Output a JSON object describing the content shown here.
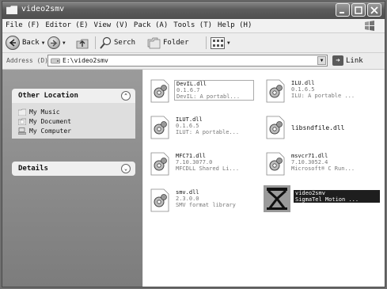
{
  "window": {
    "title": "video2smv"
  },
  "menu": {
    "items": [
      "File (F)",
      "Editor (E)",
      "View (V)",
      "Pack (A)",
      "Tools (T)",
      "Help (H)"
    ]
  },
  "toolbar": {
    "back_label": "Back",
    "search_label": "Serch",
    "folder_label": "Folder"
  },
  "address": {
    "label": "Address (D)",
    "value": "E:\\video2smv",
    "go_label": "Link"
  },
  "sidebar": {
    "other_location": {
      "title": "Other Location",
      "links": [
        "My Music",
        "My Document",
        "My Computer"
      ]
    },
    "details": {
      "title": "Details"
    }
  },
  "files": [
    {
      "name": "DevIL.dll",
      "version": "0.1.6.7",
      "description": "DevIL: A portabl..."
    },
    {
      "name": "ILU.dll",
      "version": "0.1.6.5",
      "description": "ILU: A portable ..."
    },
    {
      "name": "ILUT.dll",
      "version": "0.1.6.5",
      "description": "ILUT: A portable..."
    },
    {
      "name": "libsndfile.dll"
    },
    {
      "name": "MFC71.dll",
      "version": "7.10.3077.0",
      "description": "MFCDLL Shared Li..."
    },
    {
      "name": "msvcr71.dll",
      "version": "7.10.3052.4",
      "description": "Microsoft® C Run..."
    },
    {
      "name": "smv.dll",
      "version": "2.3.0.0",
      "description": "SMV format library"
    },
    {
      "name": "video2smv",
      "description": "SigmaTel Motion ..."
    }
  ],
  "colors": {
    "titlebar": "#5c5c5c",
    "taskpane": "#8c8c8c",
    "selection": "#1e1e1e"
  }
}
